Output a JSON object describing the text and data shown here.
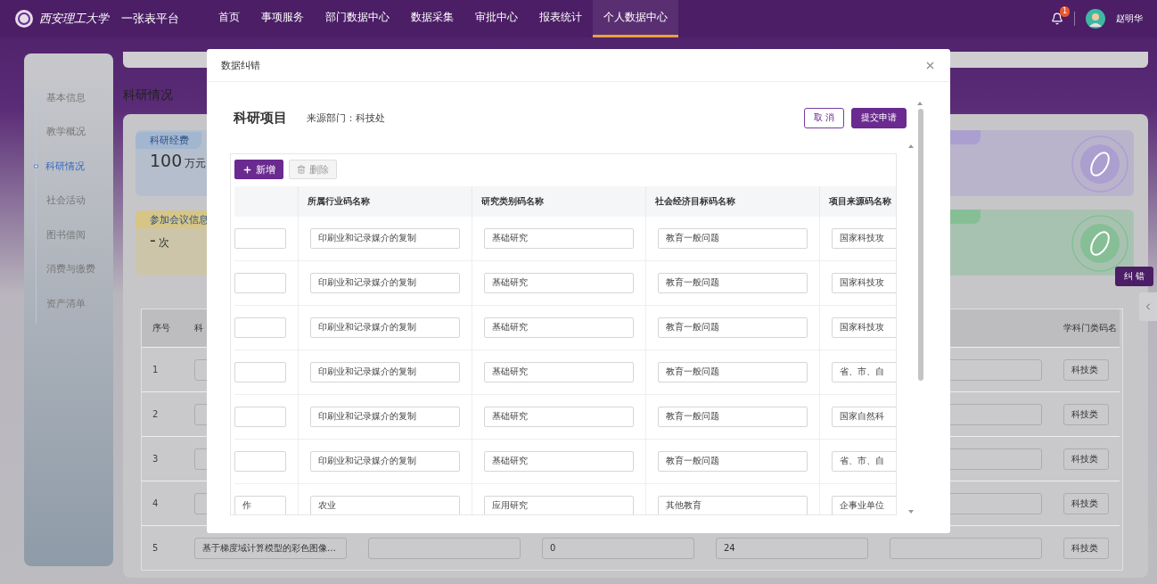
{
  "header": {
    "logo_text": "西安理工大学",
    "platform": "一张表平台",
    "nav": [
      {
        "label": "首页",
        "selected": false
      },
      {
        "label": "事项服务",
        "selected": false
      },
      {
        "label": "部门数据中心",
        "selected": false
      },
      {
        "label": "数据采集",
        "selected": false
      },
      {
        "label": "审批中心",
        "selected": false
      },
      {
        "label": "报表统计",
        "selected": false
      },
      {
        "label": "个人数据中心",
        "selected": true
      }
    ],
    "notification_badge": "1",
    "user_name": "赵明华"
  },
  "sidebar": {
    "items": [
      {
        "label": "基本信息",
        "selected": false
      },
      {
        "label": "教学概况",
        "selected": false
      },
      {
        "label": "科研情况",
        "selected": true
      },
      {
        "label": "社会活动",
        "selected": false
      },
      {
        "label": "图书借阅",
        "selected": false
      },
      {
        "label": "消费与缴费",
        "selected": false
      },
      {
        "label": "资产清单",
        "selected": false
      }
    ]
  },
  "page": {
    "title": "科研情况",
    "stats": [
      {
        "label": "科研经费",
        "value": "100",
        "unit": "万元",
        "color": "#a3b6cf"
      },
      {
        "color": "#ab9fd0"
      },
      {
        "label": "参加会议信息",
        "value": "-",
        "unit": "次",
        "color": "#d6c585"
      },
      {
        "color": "#86bf95"
      }
    ],
    "correct_button": "纠 错",
    "table": {
      "columns": [
        {
          "label": "序号"
        },
        {
          "label": "科"
        },
        {},
        {},
        {},
        {},
        {
          "label": "学科门类码名"
        }
      ],
      "rows": [
        {
          "index": "1",
          "cells": [
            {},
            {},
            {},
            {},
            {},
            {
              "value": "科技类"
            }
          ]
        },
        {
          "index": "2",
          "cells": [
            {},
            {},
            {},
            {},
            {},
            {
              "value": "科技类"
            }
          ]
        },
        {
          "index": "3",
          "cells": [
            {},
            {},
            {},
            {},
            {},
            {
              "value": "科技类"
            }
          ]
        },
        {
          "index": "4",
          "cells": [
            {},
            {},
            {},
            {},
            {},
            {
              "value": "科技类"
            }
          ]
        },
        {
          "index": "5",
          "cells": [
            {
              "value": "基于梯度域计算模型的彩色图像…"
            },
            {},
            {
              "value": "0"
            },
            {
              "value": "24"
            },
            {},
            {
              "value": "科技类"
            }
          ]
        }
      ]
    }
  },
  "dialog": {
    "title": "数据纠错",
    "section_title": "科研项目",
    "source": "来源部门：科技处",
    "buttons": [
      {
        "label": "取 消",
        "kind": "secondary"
      },
      {
        "label": "提交申请",
        "kind": "primary"
      }
    ],
    "toolbar": [
      {
        "label": "新增",
        "kind": "add",
        "disabled": false
      },
      {
        "label": "删除",
        "kind": "delete",
        "disabled": true
      }
    ],
    "columns": [
      {},
      {
        "label": "所属行业码名称"
      },
      {
        "label": "研究类别码名称"
      },
      {
        "label": "社会经济目标码名称"
      },
      {
        "label": "项目来源码名称"
      }
    ],
    "rows": [
      {
        "cells": [
          {},
          {
            "value": "印刷业和记录媒介的复制"
          },
          {
            "value": "基础研究"
          },
          {
            "value": "教育一般问题"
          },
          {
            "value": "国家科技攻"
          }
        ]
      },
      {
        "cells": [
          {},
          {
            "value": "印刷业和记录媒介的复制"
          },
          {
            "value": "基础研究"
          },
          {
            "value": "教育一般问题"
          },
          {
            "value": "国家科技攻"
          }
        ]
      },
      {
        "cells": [
          {},
          {
            "value": "印刷业和记录媒介的复制"
          },
          {
            "value": "基础研究"
          },
          {
            "value": "教育一般问题"
          },
          {
            "value": "国家科技攻"
          }
        ]
      },
      {
        "cells": [
          {},
          {
            "value": "印刷业和记录媒介的复制"
          },
          {
            "value": "基础研究"
          },
          {
            "value": "教育一般问题"
          },
          {
            "value": "省、市、自"
          }
        ]
      },
      {
        "cells": [
          {},
          {
            "value": "印刷业和记录媒介的复制"
          },
          {
            "value": "基础研究"
          },
          {
            "value": "教育一般问题"
          },
          {
            "value": "国家自然科"
          }
        ]
      },
      {
        "cells": [
          {},
          {
            "value": "印刷业和记录媒介的复制"
          },
          {
            "value": "基础研究"
          },
          {
            "value": "教育一般问题"
          },
          {
            "value": "省、市、自"
          }
        ]
      },
      {
        "cells": [
          {
            "value": "作"
          },
          {
            "value": "农业"
          },
          {
            "value": "应用研究"
          },
          {
            "value": "其他教育"
          },
          {
            "value": "企事业单位"
          }
        ]
      }
    ]
  }
}
